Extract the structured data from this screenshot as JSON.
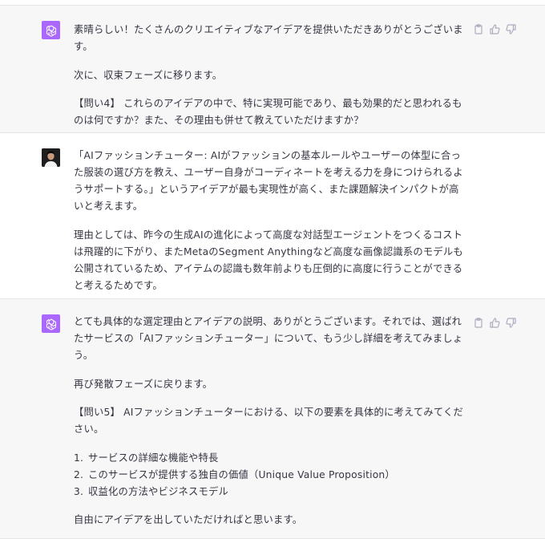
{
  "messages": [
    {
      "role": "assistant",
      "paragraphs": [
        "素晴らしい！たくさんのクリエイティブなアイデアを提供いただきありがとうございます。",
        "次に、収束フェーズに移ります。",
        "【問い4】 これらのアイデアの中で、特に実現可能であり、最も効果的だと思われるものは何ですか？また、その理由も併せて教えていただけますか？"
      ]
    },
    {
      "role": "user",
      "paragraphs": [
        "「AIファッションチューター: AIがファッションの基本ルールやユーザーの体型に合った服装の選び方を教え、ユーザー自身がコーディネートを考える力を身につけられるようサポートする。」というアイデアが最も実現性が高く、また課題解決インパクトが高いと考えます。",
        "理由としては、昨今の生成AIの進化によって高度な対話型エージェントをつくるコストは飛躍的に下がり、またMetaのSegment Anythingなど高度な画像認識系のモデルも公開されているため、アイテムの認識も数年前よりも圧倒的に高度に行うことができると考えるためです。"
      ]
    },
    {
      "role": "assistant",
      "paragraphs": [
        "とても具体的な選定理由とアイデアの説明、ありがとうございます。それでは、選ばれたサービスの「AIファッションチューター」について、もう少し詳細を考えてみましょう。",
        "再び発散フェーズに戻ります。",
        "【問い5】 AIファッションチューターにおける、以下の要素を具体的に考えてみてください。"
      ],
      "list": [
        {
          "num": "1.",
          "text": "サービスの詳細な機能や特長"
        },
        {
          "num": "2.",
          "text": "このサービスが提供する独自の価値（Unique Value Proposition）"
        },
        {
          "num": "3.",
          "text": "収益化の方法やビジネスモデル"
        }
      ],
      "closing": "自由にアイデアを出していただければと思います。"
    }
  ],
  "icons": {
    "assistant_avatar": "openai-logo-icon",
    "user_avatar": "user-photo-avatar",
    "copy": "clipboard-icon",
    "thumbs_up": "thumbs-up-icon",
    "thumbs_down": "thumbs-down-icon"
  },
  "colors": {
    "assistant_bg": "#f7f7f8",
    "avatar_accent": "#ab68ff",
    "text": "#343541",
    "icon": "#acacbe"
  }
}
